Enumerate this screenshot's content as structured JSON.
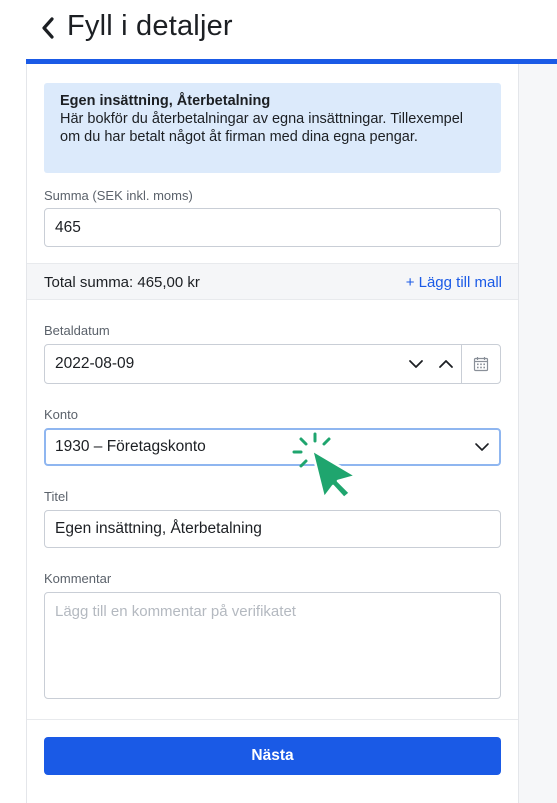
{
  "header": {
    "title": "Fyll i detaljer"
  },
  "info": {
    "title": "Egen insättning, Återbetalning",
    "description": "Här bokför du återbetalningar av egna insättningar. Tillexempel om du har betalt något åt firman med dina egna pengar."
  },
  "amount": {
    "label": "Summa (SEK inkl. moms)",
    "value": "465"
  },
  "total": {
    "text": "Total summa: 465,00 kr",
    "add_template_label": "+ Lägg till mall"
  },
  "payment_date": {
    "label": "Betaldatum",
    "value": "2022-08-09"
  },
  "account": {
    "label": "Konto",
    "value": "1930 – Företagskonto"
  },
  "title_field": {
    "label": "Titel",
    "value": "Egen insättning, Återbetalning"
  },
  "comment": {
    "label": "Kommentar",
    "placeholder": "Lägg till en kommentar på verifikatet"
  },
  "next_button": {
    "label": "Nästa"
  },
  "colors": {
    "accent": "#1a5ae6",
    "info_bg": "#dceafb",
    "cursor": "#1fa56e"
  },
  "icons": {
    "back": "chevron-left-icon",
    "calendar": "calendar-icon",
    "date_down": "chevron-down-icon",
    "date_up": "chevron-up-icon",
    "select": "chevron-down-icon",
    "pointer": "click-cursor-icon"
  }
}
